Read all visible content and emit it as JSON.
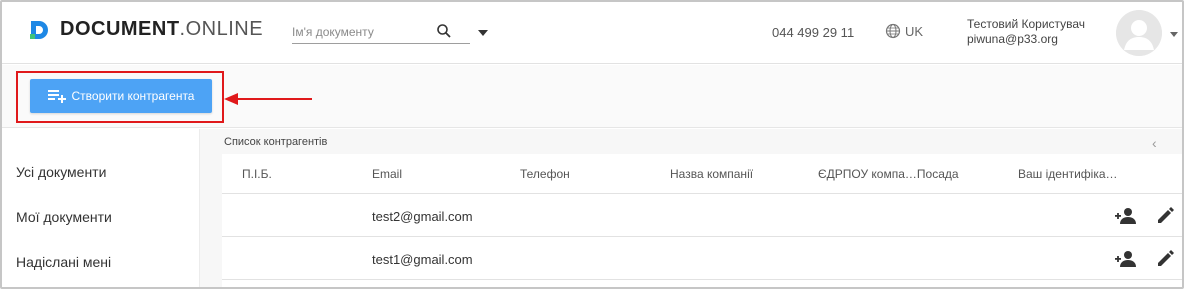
{
  "header": {
    "logo_bold": "DOCUMENT",
    "logo_dot": ".",
    "logo_light": "ONLINE",
    "search_placeholder": "Ім'я документу",
    "phone": "044 499 29 11",
    "language": "UK",
    "user_name": "Тестовий Користувач",
    "user_email": "piwuna@p33.org"
  },
  "toolbar": {
    "create_button": "Створити контрагента"
  },
  "sidebar": {
    "items": [
      {
        "label": "Усі документи"
      },
      {
        "label": "Мої документи"
      },
      {
        "label": "Надіслані мені"
      }
    ]
  },
  "content": {
    "list_title": "Список контрагентів",
    "collapse_icon": "‹",
    "columns": [
      "П.І.Б.",
      "Email",
      "Телефон",
      "Назва компанії",
      "ЄДРПОУ компа…Посада",
      "Ваш ідентифіка…"
    ],
    "rows": [
      {
        "name": "",
        "email": "test2@gmail.com",
        "phone": "",
        "company": "",
        "edrpou": "",
        "identifier": ""
      },
      {
        "name": "",
        "email": "test1@gmail.com",
        "phone": "",
        "company": "",
        "edrpou": "",
        "identifier": ""
      }
    ]
  },
  "colors": {
    "accent": "#4da3f5",
    "highlight": "#e0191b"
  },
  "icons": {
    "logo": "document-online-logo",
    "search": "search-icon",
    "language": "globe-icon",
    "avatar": "avatar",
    "create": "playlist-add-icon",
    "row_add": "add-person-icon",
    "row_edit": "pencil-icon"
  }
}
